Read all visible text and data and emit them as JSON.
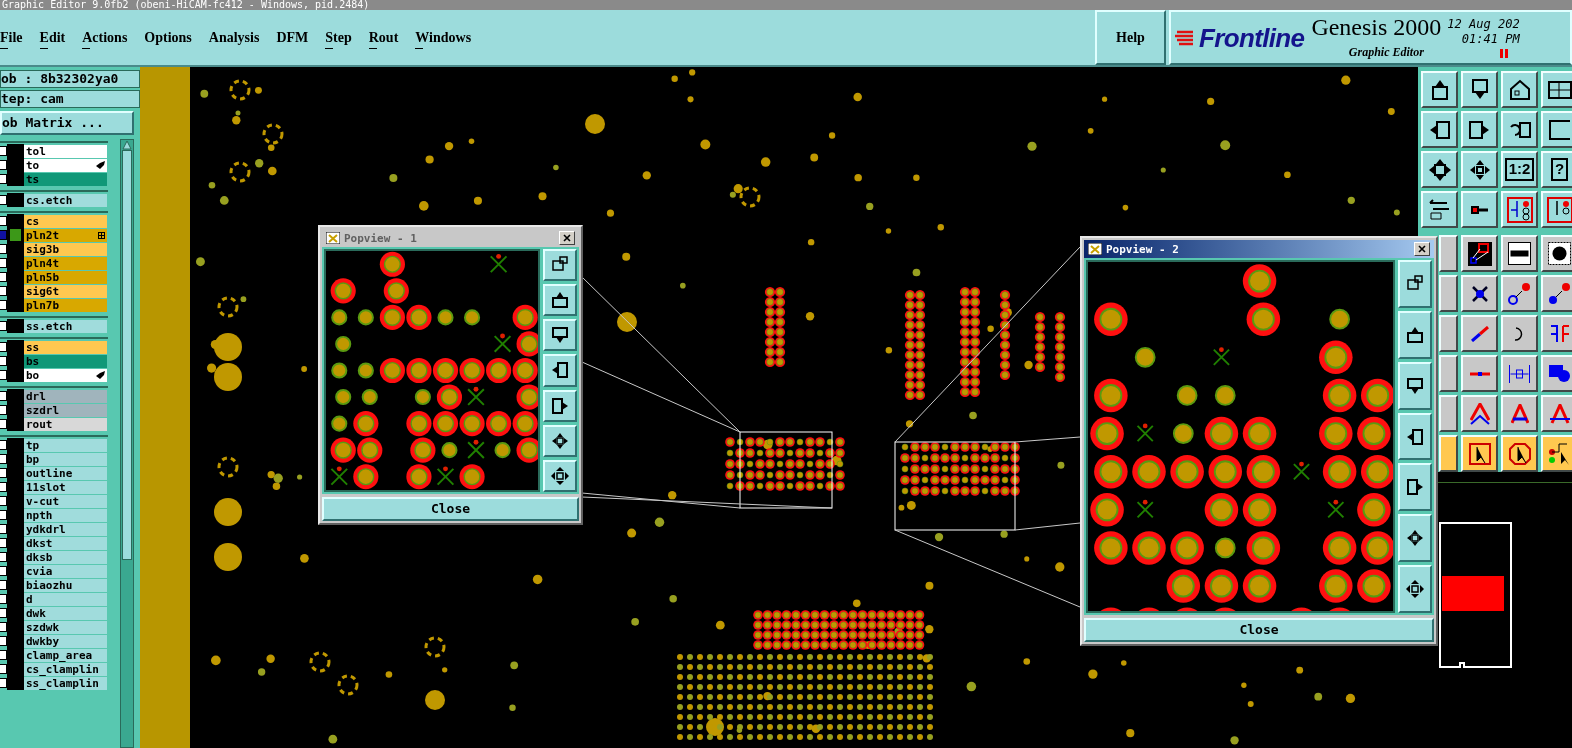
{
  "window": {
    "title": "Graphic Editor 9.0fb2 (obeni-HiCAM-fc412 - Windows, pid.2484)"
  },
  "menu": [
    {
      "label": "File",
      "underlined": true
    },
    {
      "label": "Edit",
      "underlined": true
    },
    {
      "label": "Actions",
      "underlined": true
    },
    {
      "label": "Options",
      "underlined": false
    },
    {
      "label": "Analysis",
      "underlined": false
    },
    {
      "label": "DFM",
      "underlined": false
    },
    {
      "label": "Step",
      "underlined": true
    },
    {
      "label": "Rout",
      "underlined": true
    },
    {
      "label": "Windows",
      "underlined": true
    }
  ],
  "help": "Help",
  "brand": {
    "logo": "Frontline",
    "product": "Genesis 2000",
    "subtitle": "Graphic Editor",
    "date": "12 Aug 202",
    "time": "01:41 PM"
  },
  "job": {
    "job": "ob : 8b32302ya0",
    "step": "tep: cam",
    "matrix_button": "ob Matrix ..."
  },
  "layer_groups": [
    {
      "layers": [
        {
          "name": "tol",
          "color": "#ffffff",
          "selected": false,
          "kind": "plain"
        },
        {
          "name": "to",
          "color": "#ffffff",
          "selected": false,
          "kind": "hand"
        },
        {
          "name": "ts",
          "color": "#109878",
          "selected": false,
          "kind": "plain"
        }
      ]
    },
    {
      "layers": [
        {
          "name": "cs.etch",
          "color": "#a0dcdc",
          "selected": false,
          "kind": "plain"
        }
      ]
    },
    {
      "layers": [
        {
          "name": "cs",
          "color": "#ffc850",
          "selected": false,
          "kind": "plain"
        },
        {
          "name": "pln2t",
          "color": "#d8a800",
          "selected": true,
          "kind": "grid"
        },
        {
          "name": "sig3b",
          "color": "#ffc850",
          "selected": false,
          "kind": "plain"
        },
        {
          "name": "pln4t",
          "color": "#d8a800",
          "selected": false,
          "kind": "plain"
        },
        {
          "name": "pln5b",
          "color": "#d8a800",
          "selected": false,
          "kind": "plain"
        },
        {
          "name": "sig6t",
          "color": "#ffc850",
          "selected": false,
          "kind": "plain"
        },
        {
          "name": "pln7b",
          "color": "#d8a800",
          "selected": false,
          "kind": "plain"
        }
      ]
    },
    {
      "layers": [
        {
          "name": "ss.etch",
          "color": "#a0dcdc",
          "selected": false,
          "kind": "plain"
        }
      ]
    },
    {
      "layers": [
        {
          "name": "ss",
          "color": "#ffc850",
          "selected": false,
          "kind": "plain"
        },
        {
          "name": "bs",
          "color": "#109878",
          "selected": false,
          "kind": "plain"
        },
        {
          "name": "bo",
          "color": "#ffffff",
          "selected": false,
          "kind": "hand"
        }
      ]
    },
    {
      "layers": [
        {
          "name": "drl",
          "color": "#a0b4bc",
          "selected": false,
          "kind": "plain"
        },
        {
          "name": "szdrl",
          "color": "#a0b4bc",
          "selected": false,
          "kind": "plain"
        },
        {
          "name": "rout",
          "color": "#d8d8d8",
          "selected": false,
          "kind": "plain"
        }
      ]
    },
    {
      "layers": [
        {
          "name": "tp",
          "color": "#a0dcdc",
          "selected": false,
          "kind": "plain"
        },
        {
          "name": "bp",
          "color": "#a0dcdc",
          "selected": false,
          "kind": "plain"
        },
        {
          "name": "outline",
          "color": "#a0dcdc",
          "selected": false,
          "kind": "plain"
        },
        {
          "name": "11slot",
          "color": "#a0dcdc",
          "selected": false,
          "kind": "plain"
        },
        {
          "name": "v-cut",
          "color": "#a0dcdc",
          "selected": false,
          "kind": "plain"
        },
        {
          "name": "npth",
          "color": "#a0dcdc",
          "selected": false,
          "kind": "plain"
        },
        {
          "name": "ydkdrl",
          "color": "#a0dcdc",
          "selected": false,
          "kind": "plain"
        },
        {
          "name": "dkst",
          "color": "#a0dcdc",
          "selected": false,
          "kind": "plain"
        },
        {
          "name": "dksb",
          "color": "#a0dcdc",
          "selected": false,
          "kind": "plain"
        },
        {
          "name": "cvia",
          "color": "#a0dcdc",
          "selected": false,
          "kind": "plain"
        },
        {
          "name": "biaozhu",
          "color": "#a0dcdc",
          "selected": false,
          "kind": "plain"
        },
        {
          "name": "d",
          "color": "#a0dcdc",
          "selected": false,
          "kind": "plain"
        },
        {
          "name": "dwk",
          "color": "#a0dcdc",
          "selected": false,
          "kind": "plain"
        },
        {
          "name": "szdwk",
          "color": "#a0dcdc",
          "selected": false,
          "kind": "plain"
        },
        {
          "name": "dwkby",
          "color": "#a0dcdc",
          "selected": false,
          "kind": "plain"
        },
        {
          "name": "clamp_area",
          "color": "#a0dcdc",
          "selected": false,
          "kind": "plain"
        },
        {
          "name": "cs_clamplin",
          "color": "#a0dcdc",
          "selected": false,
          "kind": "plain"
        },
        {
          "name": "ss_clamplin",
          "color": "#a0dcdc",
          "selected": false,
          "kind": "plain"
        }
      ]
    }
  ],
  "toolbar": {
    "labels": [
      "1:2",
      "?"
    ]
  },
  "popviews": [
    {
      "title": "Popview - 1",
      "active": false,
      "close": "Close"
    },
    {
      "title": "Popview - 2",
      "active": true,
      "close": "Close"
    }
  ]
}
